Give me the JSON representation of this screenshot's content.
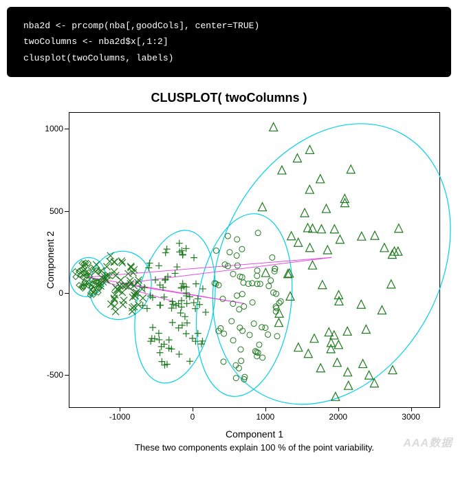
{
  "code": {
    "line1": "nba2d <- prcomp(nba[,goodCols], center=TRUE)",
    "line2": "twoColumns <- nba2d$x[,1:2]",
    "line3": "clusplot(twoColumns, labels)"
  },
  "chart_data": {
    "type": "scatter",
    "title": "CLUSPLOT( twoColumns )",
    "xlabel": "Component 1",
    "ylabel": "Component 2",
    "sub_caption": "These two components explain 100 % of the point variability.",
    "xlim": [
      -1700,
      3400
    ],
    "ylim": [
      -700,
      1100
    ],
    "x_ticks": [
      -1000,
      0,
      1000,
      2000,
      3000
    ],
    "y_ticks": [
      -500,
      0,
      500,
      1000
    ],
    "colors": {
      "point": "#1e7a1e",
      "ellipse": "#00d0e6",
      "centroid_line": "#e64de6"
    },
    "clusters": [
      {
        "name": "cluster-1",
        "marker": "diamond",
        "centroid": [
          -1450,
          100
        ],
        "ellipse": {
          "cx": -1450,
          "cy": 100,
          "rx": 240,
          "ry": 120,
          "angle": -15
        },
        "n_points": 55
      },
      {
        "name": "cluster-2",
        "marker": "x",
        "centroid": [
          -1000,
          60
        ],
        "ellipse": {
          "cx": -1000,
          "cy": 50,
          "rx": 420,
          "ry": 210,
          "angle": -18
        },
        "n_points": 60
      },
      {
        "name": "cluster-3",
        "marker": "plus",
        "centroid": [
          -250,
          -50
        ],
        "ellipse": {
          "cx": -250,
          "cy": -80,
          "rx": 530,
          "ry": 470,
          "angle": -10
        },
        "n_points": 80
      },
      {
        "name": "cluster-4",
        "marker": "circle",
        "centroid": [
          700,
          -60
        ],
        "ellipse": {
          "cx": 700,
          "cy": -70,
          "rx": 640,
          "ry": 560,
          "angle": -8
        },
        "n_points": 70
      },
      {
        "name": "cluster-5",
        "marker": "triangle",
        "centroid": [
          1900,
          220
        ],
        "ellipse": {
          "cx": 1900,
          "cy": 180,
          "rx": 1500,
          "ry": 900,
          "angle": -28
        },
        "n_points": 60
      }
    ],
    "centroid_lines": [
      [
        [
          -1450,
          100
        ],
        [
          1900,
          220
        ]
      ],
      [
        [
          -1450,
          100
        ],
        [
          700,
          -60
        ]
      ],
      [
        [
          -1450,
          100
        ],
        [
          -250,
          -50
        ]
      ],
      [
        [
          -1000,
          60
        ],
        [
          1900,
          220
        ]
      ],
      [
        [
          -1000,
          60
        ],
        [
          700,
          -60
        ]
      ]
    ]
  },
  "watermark": "AAA数据"
}
